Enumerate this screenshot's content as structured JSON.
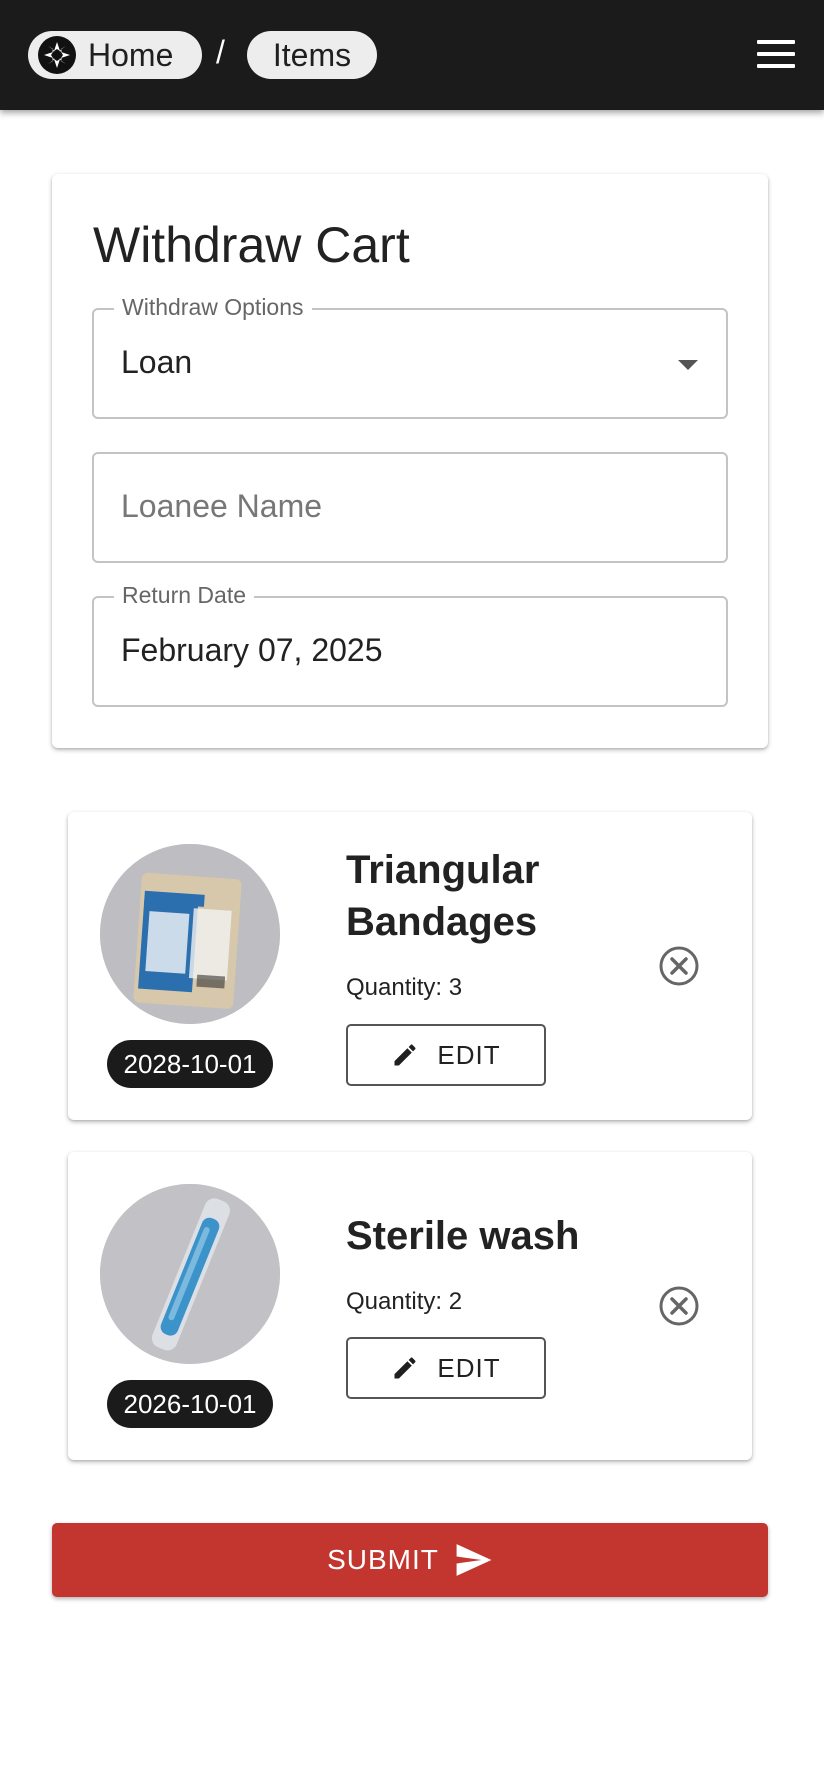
{
  "nav": {
    "breadcrumbs": [
      {
        "label": "Home",
        "icon": "first-aid-cross-logo"
      },
      {
        "label": "Items"
      }
    ],
    "separator": "/",
    "menu_icon": "hamburger-menu-icon"
  },
  "form": {
    "title": "Withdraw Cart",
    "withdraw_options": {
      "label": "Withdraw Options",
      "value": "Loan"
    },
    "loanee_name": {
      "placeholder": "Loanee Name",
      "value": ""
    },
    "return_date": {
      "label": "Return Date",
      "value": "February 07, 2025"
    }
  },
  "items": [
    {
      "name": "Triangular Bandages",
      "quantity_label": "Quantity: 3",
      "date": "2028-10-01",
      "edit_label": "EDIT",
      "image": "bandage-package-photo"
    },
    {
      "name": "Sterile wash",
      "quantity_label": "Quantity: 2",
      "date": "2026-10-01",
      "edit_label": "EDIT",
      "image": "sterile-wash-tube-photo"
    }
  ],
  "submit_label": "SUBMIT",
  "colors": {
    "topbar": "#1b1b1b",
    "submit": "#c2362f",
    "date_badge": "#1b1b1b"
  }
}
